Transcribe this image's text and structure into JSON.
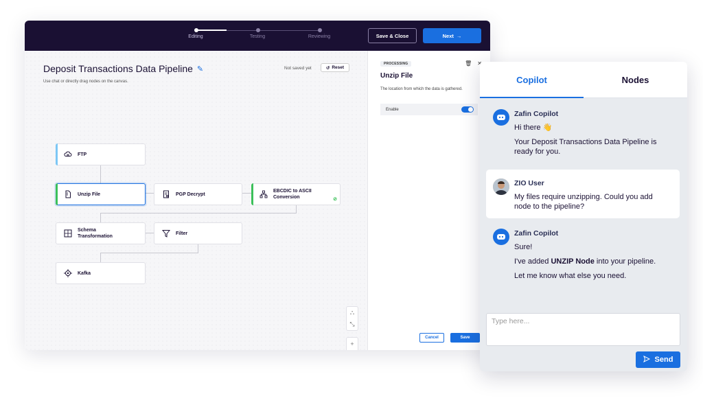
{
  "topbar": {
    "steps": [
      "Editing",
      "Testing",
      "Reviewing"
    ],
    "save_close": "Save & Close",
    "next": "Next"
  },
  "canvas": {
    "title": "Deposit Transactions Data Pipeline",
    "subtitle": "Use chat or directly drag nodes on the canvas.",
    "status": "Not saved yet",
    "reset": "Reset",
    "nodes": [
      {
        "label": "FTP",
        "icon": "cloud-icon",
        "accent": "#7cc7f5"
      },
      {
        "label": "Unzip File",
        "icon": "file-icon",
        "accent": "#3cc05a"
      },
      {
        "label": "PGP Decrypt",
        "icon": "document-lock-icon"
      },
      {
        "label": "EBCDIC to ASCII Conversion",
        "icon": "hierarchy-icon",
        "accent": "#3cc05a"
      },
      {
        "label": "Schema Transformation",
        "icon": "grid-icon"
      },
      {
        "label": "Filter",
        "icon": "filter-icon"
      },
      {
        "label": "Kafka",
        "icon": "target-icon"
      }
    ]
  },
  "panel": {
    "badge": "PROCESSING",
    "title": "Unzip File",
    "description": "The location from which the data is gathered.",
    "enable_label": "Enable",
    "enabled": true,
    "cancel": "Cancel",
    "save": "Save"
  },
  "copilot": {
    "tabs": [
      "Copilot",
      "Nodes"
    ],
    "messages": [
      {
        "sender": "Zafin Copilot",
        "lines": [
          "Hi there 👋",
          "Your Deposit Transactions Data Pipeline is ready for you."
        ]
      },
      {
        "sender": "ZIO User",
        "lines": [
          "My files require unzipping. Could you add node to the pipeline?"
        ]
      },
      {
        "sender": "Zafin Copilot",
        "lines": [
          "Sure!",
          "I've added",
          "UNZIP Node",
          "into your pipeline.",
          "Let me know what else you need."
        ]
      }
    ],
    "input_placeholder": "Type here...",
    "send": "Send"
  },
  "colors": {
    "accent": "#1a6fe0",
    "topbar": "#1a1033",
    "success": "#3cc05a"
  }
}
